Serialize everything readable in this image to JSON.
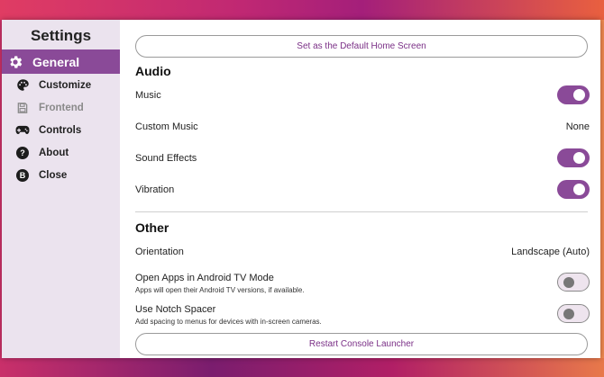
{
  "sidebar": {
    "title": "Settings",
    "items": [
      {
        "label": "General",
        "icon": "gear-icon",
        "active": true
      },
      {
        "label": "Customize",
        "icon": "palette-icon"
      },
      {
        "label": "Frontend",
        "icon": "save-icon",
        "disabled": true
      },
      {
        "label": "Controls",
        "icon": "gamepad-icon"
      },
      {
        "label": "About",
        "icon": "help-icon",
        "glyph": "?"
      },
      {
        "label": "Close",
        "icon": "b-button-icon",
        "glyph": "B"
      }
    ]
  },
  "main": {
    "default_home_label": "Set as the Default Home Screen",
    "audio": {
      "title": "Audio",
      "music": {
        "label": "Music",
        "enabled": true
      },
      "custom_music": {
        "label": "Custom Music",
        "value": "None"
      },
      "sound_effects": {
        "label": "Sound Effects",
        "enabled": true
      },
      "vibration": {
        "label": "Vibration",
        "enabled": true
      }
    },
    "other": {
      "title": "Other",
      "orientation": {
        "label": "Orientation",
        "value": "Landscape (Auto)"
      },
      "android_tv": {
        "label": "Open Apps in Android TV Mode",
        "description": "Apps will open their Android TV versions, if available.",
        "enabled": false
      },
      "notch_spacer": {
        "label": "Use Notch Spacer",
        "description": "Add spacing to menus for devices with in-screen cameras.",
        "enabled": false
      }
    },
    "restart_label": "Restart Console Launcher"
  },
  "colors": {
    "accent": "#8a4a98",
    "sidebar_bg": "#ebe3ee",
    "button_text": "#7a2f86"
  }
}
